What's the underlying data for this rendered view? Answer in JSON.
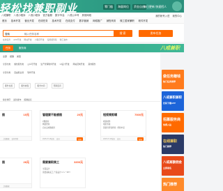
{
  "banner": {
    "headline": "轻松找兼职副业",
    "tags": [
      "零门槛",
      "海量岗位",
      "资金自由"
    ],
    "note": "每日更新 快速招人"
  },
  "topnav": {
    "items": [
      "八戒兼职",
      "八戒小程序",
      "八戒小程序",
      "官方客服",
      "数字币会",
      "八戒公众号",
      "其他网络"
    ],
    "right": [
      "我的帐号入驻",
      "我的中心"
    ]
  },
  "catnav": {
    "items": [
      "首页",
      "技术开发",
      "营业开发",
      "在线任务",
      "技术开发",
      "在线支付",
      "数字营销",
      "网络推广",
      "销售商务",
      "微工居家兼职",
      "软件开发"
    ]
  },
  "search": {
    "select_label": "搜索",
    "placeholder": "输入任务名称",
    "button_label": "搜 索",
    "post_label": "发布任务",
    "hotwords": [
      "在线任务",
      "APP开发",
      "网站开发",
      "小程序开发",
      "短视频剪辑",
      "微工发布"
    ]
  },
  "subbar": {
    "active": "任务",
    "second": "服务商",
    "logo": "八戒兼职"
  },
  "crumbs": [
    "全部",
    "报酬",
    "类型"
  ],
  "filters": {
    "row1": [
      "全部分类",
      "餐饮服务类",
      "公众号开发",
      "生产管理软件开发",
      "UI设计开发",
      "网站定制开发",
      "其他服务"
    ],
    "row2": [
      "全部分类",
      "自由职业者",
      "软件开发"
    ],
    "dropdowns": [
      "服务位置",
      "服务类型",
      "服务时间",
      "预算区间"
    ],
    "sort": [
      "综合排序",
      "最新发布",
      "报酬最高"
    ]
  },
  "cards": [
    {
      "title": "图",
      "price": "15元",
      "lines": [
        "",
        ""
      ],
      "foot": [
        "上线数据",
        "会有经验"
      ],
      "btn": ""
    },
    {
      "title": "管理要不能感图",
      "price": "20元",
      "lines": [
        "P数据库",
        "网络经验",
        "自主完成数据库"
      ],
      "foot": [
        "2025-07-16发布",
        "会员"
      ],
      "btn": "投标"
    },
    {
      "title": "短视频剪辑",
      "price": "7000元",
      "lines": [
        "视频制作",
        "电影剪辑",
        "需要有剪辑经验 - 经验丰富"
      ],
      "foot": [
        "2025-07-15发布",
        "会员"
      ],
      "btn": "投标"
    },
    {
      "title": "图",
      "price": "28元",
      "lines": [
        "",
        ""
      ],
      "foot": [
        "上线数据",
        ""
      ],
      "btn": ""
    },
    {
      "title": "需要兼职美工",
      "price": "3200元",
      "lines": [
        "平面设计",
        "需要兼职美工 产品设计 6 人一PPT"
      ],
      "foot": [
        "",
        ""
      ],
      "btn": ""
    }
  ],
  "ads": [
    {
      "line1": "做任务赚钱",
      "line2": "热门任务推荐",
      "color": "#ff7b1c"
    },
    {
      "line1": "八戒兼职兼职",
      "line2": "扫码下载APP",
      "color": "#1c64d9"
    },
    {
      "line1": "招募服务商",
      "line2": "免费入驻",
      "color": "#ff6a00"
    },
    {
      "line1": "在线兼职",
      "line2": "热门推荐",
      "color": "#2b3a66"
    },
    {
      "line1": "八戒高额佣金",
      "line2": "立即报名",
      "color": "#e84a1a"
    },
    {
      "line1": "热门推荐",
      "line2": "",
      "color": "#ff8a2a"
    }
  ]
}
